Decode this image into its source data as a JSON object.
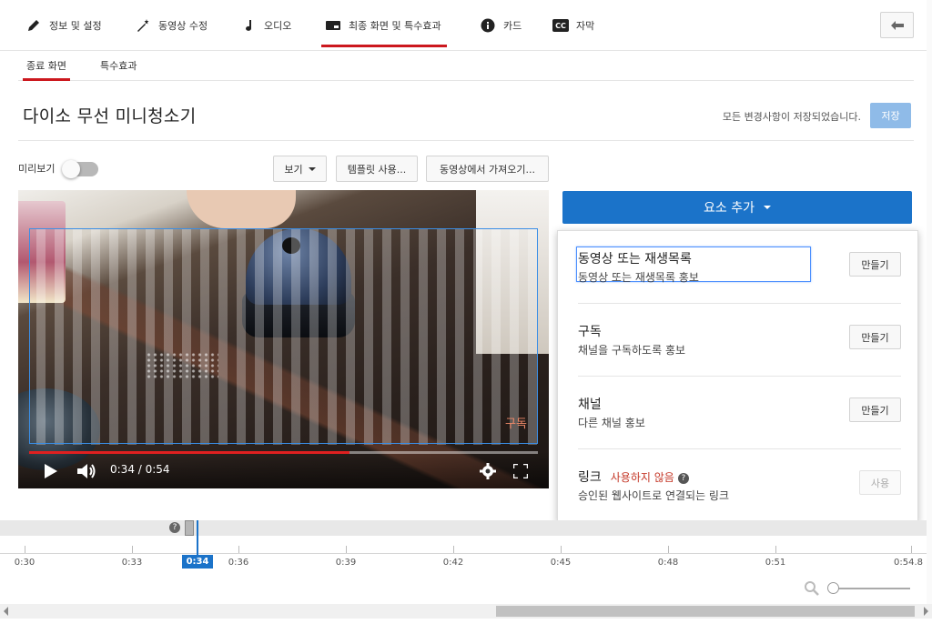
{
  "top_tabs": [
    {
      "label": "정보 및 설정",
      "icon": "pencil-icon"
    },
    {
      "label": "동영상 수정",
      "icon": "magic-wand-icon"
    },
    {
      "label": "오디오",
      "icon": "music-note-icon"
    },
    {
      "label": "최종 화면 및 특수효과",
      "icon": "end-screen-icon",
      "active": true
    },
    {
      "label": "카드",
      "icon": "info-icon"
    },
    {
      "label": "자막",
      "icon": "cc-icon"
    }
  ],
  "sub_tabs": [
    {
      "label": "종료 화면",
      "active": true
    },
    {
      "label": "특수효과"
    }
  ],
  "page": {
    "title": "다이소 무선 미니청소기",
    "save_status": "모든 변경사항이 저장되었습니다.",
    "save_label": "저장"
  },
  "toolbar": {
    "preview_label": "미리보기",
    "preview_on": false,
    "view_label": "보기",
    "template_label": "템플릿 사용...",
    "import_label": "동영상에서 가져오기..."
  },
  "video": {
    "time": "0:34 / 0:54",
    "progress": 0.63,
    "watermark": "구독"
  },
  "add_element": {
    "label": "요소 추가",
    "items": [
      {
        "title": "동영상 또는 재생목록",
        "desc": "동영상 또는 재생목록 홍보",
        "button": "만들기"
      },
      {
        "title": "구독",
        "desc": "채널을 구독하도록 홍보",
        "button": "만들기"
      },
      {
        "title": "채널",
        "desc": "다른 채널 홍보",
        "button": "만들기"
      },
      {
        "title": "링크",
        "status": "사용하지 않음",
        "desc": "승인된 웹사이트로 연결되는 링크",
        "button": "사용"
      }
    ]
  },
  "timeline": {
    "playhead": "0:34",
    "ticks": [
      "0:30",
      "0:33",
      "0:36",
      "0:39",
      "0:42",
      "0:45",
      "0:48",
      "0:51",
      "0:54.8"
    ]
  },
  "colors": {
    "accent_red": "#cc181e",
    "accent_blue": "#1b73c9",
    "warning_red": "#c53929"
  }
}
